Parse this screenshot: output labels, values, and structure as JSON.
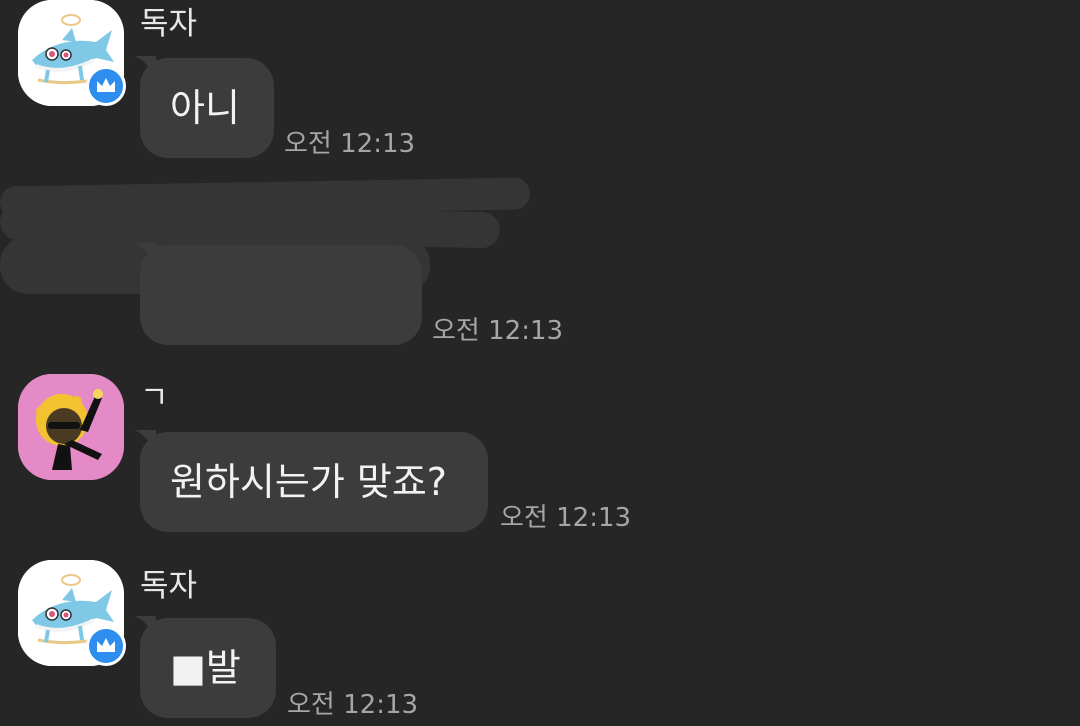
{
  "messages": [
    {
      "sender": "독자",
      "text": "아니",
      "time": "오전 12:13"
    },
    {
      "sender": "",
      "text": "",
      "time": "오전 12:13"
    },
    {
      "sender": "ㄱ",
      "text": "원하시는가 맞죠?",
      "time": "오전 12:13"
    },
    {
      "sender": "독자",
      "text": "■발",
      "time": "오전 12:13"
    }
  ],
  "colors": {
    "background": "#262626",
    "bubble": "#3c3c3c",
    "badge": "#2e8ef0",
    "avatar_pink": "#e48ac6"
  },
  "icons": [
    "shark-avatar-icon",
    "crown-badge-icon",
    "character-avatar-icon"
  ]
}
